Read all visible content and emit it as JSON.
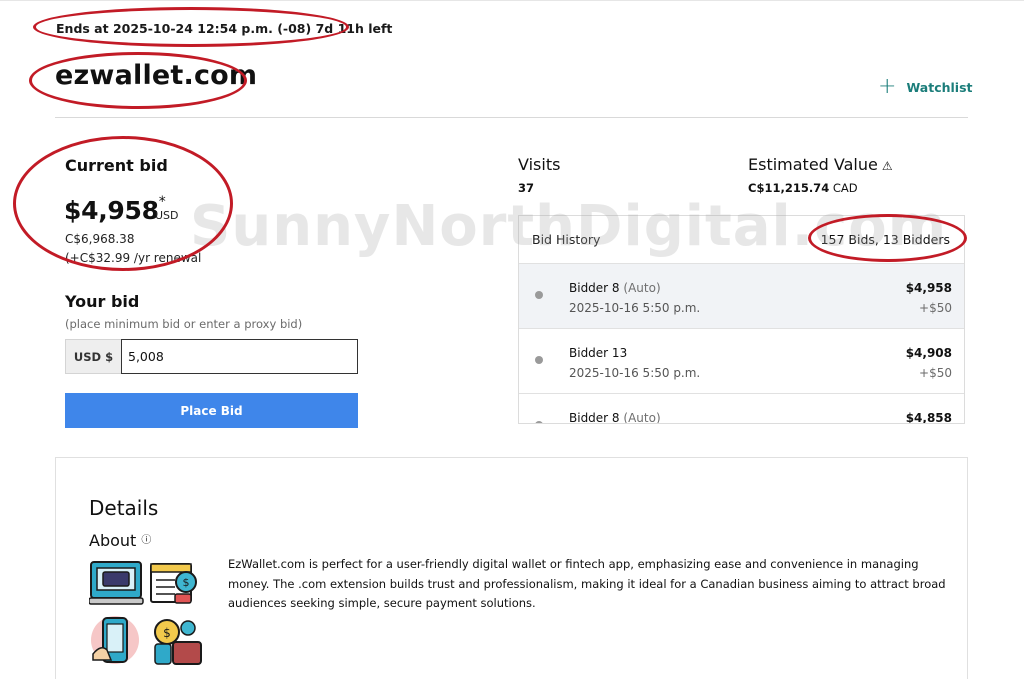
{
  "auction": {
    "ends_text": "Ends at 2025-10-24 12:54 p.m. (-08) 7d 11h left",
    "domain": "ezwallet.com",
    "watchlist_label": "Watchlist"
  },
  "current_bid": {
    "label": "Current bid",
    "amount": "$4,958",
    "asterisk": "*",
    "currency": "USD",
    "cad_equivalent": "C$6,968.38",
    "renewal": "(+C$32.99 /yr renewal"
  },
  "your_bid": {
    "label": "Your bid",
    "hint": "(place minimum bid or enter a proxy bid)",
    "prefix": "USD $",
    "value": "5,008",
    "button_label": "Place Bid"
  },
  "stats": {
    "visits_label": "Visits",
    "visits_value": "37",
    "estimated_label": "Estimated Value",
    "estimated_value": "C$11,215.74",
    "estimated_currency": "CAD"
  },
  "history": {
    "title": "Bid History",
    "count_text": "157 Bids, 13 Bidders",
    "rows": [
      {
        "bidder": "Bidder 8",
        "tag": "(Auto)",
        "date": "2025-10-16 5:50 p.m.",
        "amount": "$4,958",
        "increment": "+$50"
      },
      {
        "bidder": "Bidder 13",
        "tag": "",
        "date": "2025-10-16 5:50 p.m.",
        "amount": "$4,908",
        "increment": "+$50"
      },
      {
        "bidder": "Bidder 8",
        "tag": "(Auto)",
        "date": "",
        "amount": "$4,858",
        "increment": ""
      }
    ]
  },
  "details": {
    "title": "Details",
    "about_label": "About",
    "about_text": "EzWallet.com is perfect for a user-friendly digital wallet or fintech app, emphasizing ease and convenience in managing money. The .com extension builds trust and professionalism, making it ideal for a Canadian business aiming to attract broad audiences seeking simple, secure payment solutions."
  },
  "watermark": "SunnyNorthDigital.com",
  "colors": {
    "accent_teal": "#1b7d7a",
    "button_blue": "#3f86ea",
    "annotation_red": "#c21b26"
  }
}
